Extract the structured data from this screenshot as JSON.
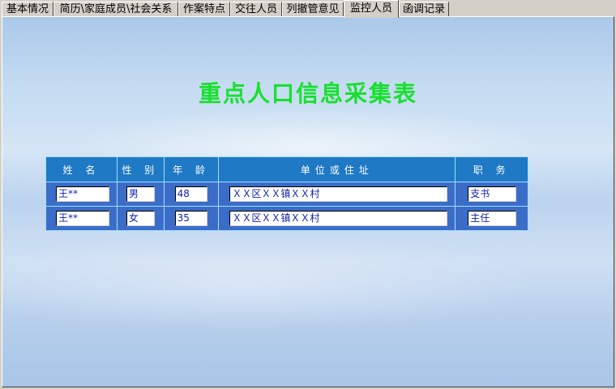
{
  "tabs": [
    {
      "label": "基本情况"
    },
    {
      "label": "简历\\家庭成员\\社会关系"
    },
    {
      "label": "作案特点"
    },
    {
      "label": "交往人员"
    },
    {
      "label": "列撤管意见"
    },
    {
      "label": "监控人员"
    },
    {
      "label": "函调记录"
    }
  ],
  "active_tab": "监控人员",
  "form": {
    "title": "重点人口信息采集表",
    "columns": [
      "姓    名",
      "性 别",
      "年  龄",
      "单位或住址",
      "职  务"
    ],
    "rows": [
      {
        "name": "王**",
        "gender": "男",
        "age": "48",
        "address": "ＸＸ区ＸＸ镇ＸＸ村",
        "position": "支书"
      },
      {
        "name": "王**",
        "gender": "女",
        "age": "35",
        "address": "ＸＸ区ＸＸ镇ＸＸ村",
        "position": "主任"
      }
    ]
  },
  "colors": {
    "title": "#17e02d",
    "header_bg": "#1f79c5",
    "row_bg": "#3b6dc8",
    "grid_line": "#9ee0ff",
    "value_text": "#0d1fa8"
  }
}
